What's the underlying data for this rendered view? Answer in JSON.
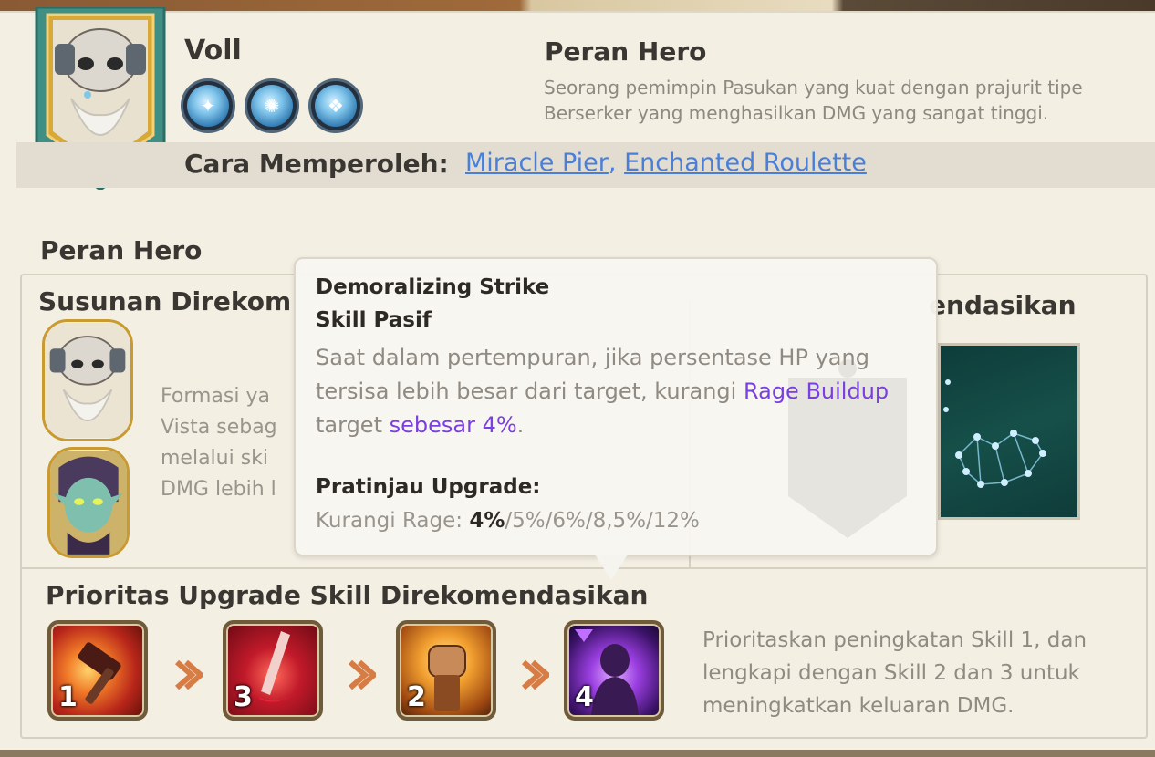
{
  "hero": {
    "name": "Voll",
    "class_icons": [
      "infantry-class-icon",
      "berserker-class-icon",
      "troop-class-icon"
    ]
  },
  "role": {
    "title": "Peran Hero",
    "description": "Seorang pemimpin Pasukan yang kuat dengan prajurit tipe Berserker yang menghasilkan DMG yang sangat tinggi."
  },
  "acquire": {
    "label": "Cara Memperoleh:",
    "link1": "Miracle Pier",
    "separator": ",",
    "link2": "Enchanted Roulette"
  },
  "sections": {
    "hero_role": "Peran Hero",
    "recommended_lineup": "Susunan Direkom",
    "recommended_right": "endasikan",
    "skill_priority": "Prioritas Upgrade Skill Direkomendasikan"
  },
  "formation_text_lines": [
    "Formasi ya",
    "Vista sebag",
    "melalui ski",
    "DMG lebih l"
  ],
  "tooltip": {
    "skill_name": "Demoralizing Strike",
    "skill_type": "Skill Pasif",
    "desc_part1": "Saat dalam pertempuran, jika persentase HP yang tersisa lebih besar dari target, kurangi ",
    "desc_hl1": "Rage Buildup",
    "desc_part2": " target ",
    "desc_hl2": "sebesar 4%",
    "desc_part3": ".",
    "upgrade_label": "Pratinjau Upgrade:",
    "upgrade_prefix": "Kurangi Rage: ",
    "upgrade_current": "4%",
    "upgrade_rest": "/5%/6%/8,5%/12%"
  },
  "skill_priority": {
    "skills": [
      {
        "num": "1",
        "icon": "hammer-strike-icon"
      },
      {
        "num": "3",
        "icon": "blood-blade-icon"
      },
      {
        "num": "2",
        "icon": "fist-icon"
      },
      {
        "num": "4",
        "icon": "dark-aura-icon"
      }
    ],
    "description_lines": [
      "Prioritaskan peningkatan Skill 1, dan",
      "lengkapi dengan Skill 2 dan 3 untuk",
      "meningkatkan keluaran DMG."
    ]
  },
  "colors": {
    "link": "#4a7fd8",
    "highlight": "#7a3fe0",
    "banner": "#3f8f84",
    "arrow": "#d67c44"
  }
}
